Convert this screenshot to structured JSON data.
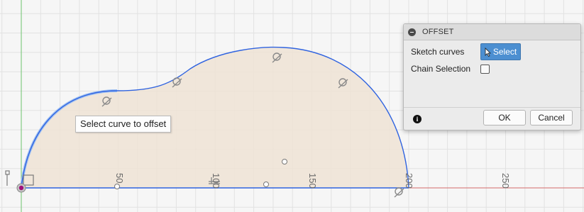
{
  "canvas": {
    "axis_labels": [
      "50",
      "100",
      "150",
      "200",
      "250"
    ],
    "colors": {
      "background": "#f6f6f6",
      "grid": "#e2e2e2",
      "profile_fill": "#efe3d5",
      "curve": "#2f63e0",
      "x_axis": "#d46a6a",
      "y_axis": "#6cc36c",
      "origin": "#a0107a"
    }
  },
  "tooltip": {
    "text": "Select curve to offset"
  },
  "dialog": {
    "title": "OFFSET",
    "sketch_curves_label": "Sketch curves",
    "select_label": "Select",
    "chain_selection_label": "Chain Selection",
    "chain_selection_checked": false,
    "ok_label": "OK",
    "cancel_label": "Cancel",
    "icons": {
      "collapse": "collapse-minus-icon",
      "cursor": "arrow-cursor-icon",
      "info": "info-icon"
    }
  }
}
